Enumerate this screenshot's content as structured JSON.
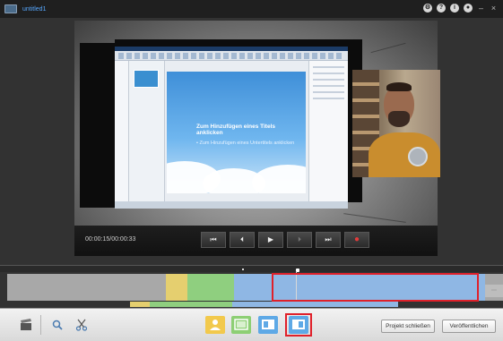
{
  "window": {
    "title": "untitled1",
    "top_icons": [
      "gear-icon",
      "help-icon",
      "info-icon",
      "user-icon"
    ],
    "minimize": "–",
    "close": "×"
  },
  "preview": {
    "slide_title": "Zum Hinzufügen eines Titels anklicken",
    "slide_bullet": "Zum Hinzufügen eines Untertitels anklicken",
    "timecode": "00:00:15/00:00:33",
    "controls": [
      {
        "name": "rewind-to-start-button",
        "glyph": "⏮"
      },
      {
        "name": "step-back-button",
        "glyph": "⏴"
      },
      {
        "name": "play-button",
        "glyph": "▶"
      },
      {
        "name": "step-forward-button",
        "glyph": "⏵"
      },
      {
        "name": "skip-to-end-button",
        "glyph": "⏭"
      },
      {
        "name": "record-button",
        "glyph": "●"
      }
    ]
  },
  "timeline": {
    "segments": [
      {
        "color": "#a8a8a8"
      },
      {
        "color": "#e5cf6f"
      },
      {
        "color": "#8fcf7f"
      },
      {
        "color": "#8fb7e4"
      },
      {
        "color": "#8fb7e4"
      }
    ],
    "playhead_time": "00:00:15"
  },
  "toolbar": {
    "icons": [
      "clapperboard-icon",
      "zoom-icon",
      "scissors-icon"
    ],
    "layout_modes": [
      "webcam-only-mode",
      "screen-only-mode",
      "webcam-left-mode",
      "webcam-right-mode"
    ],
    "close_project_label": "Projekt schließen",
    "publish_label": "Veröffentlichen"
  },
  "colors": {
    "accent": "#4aa3e8",
    "highlight": "#e0202a",
    "title_text": "#57a8ff"
  }
}
